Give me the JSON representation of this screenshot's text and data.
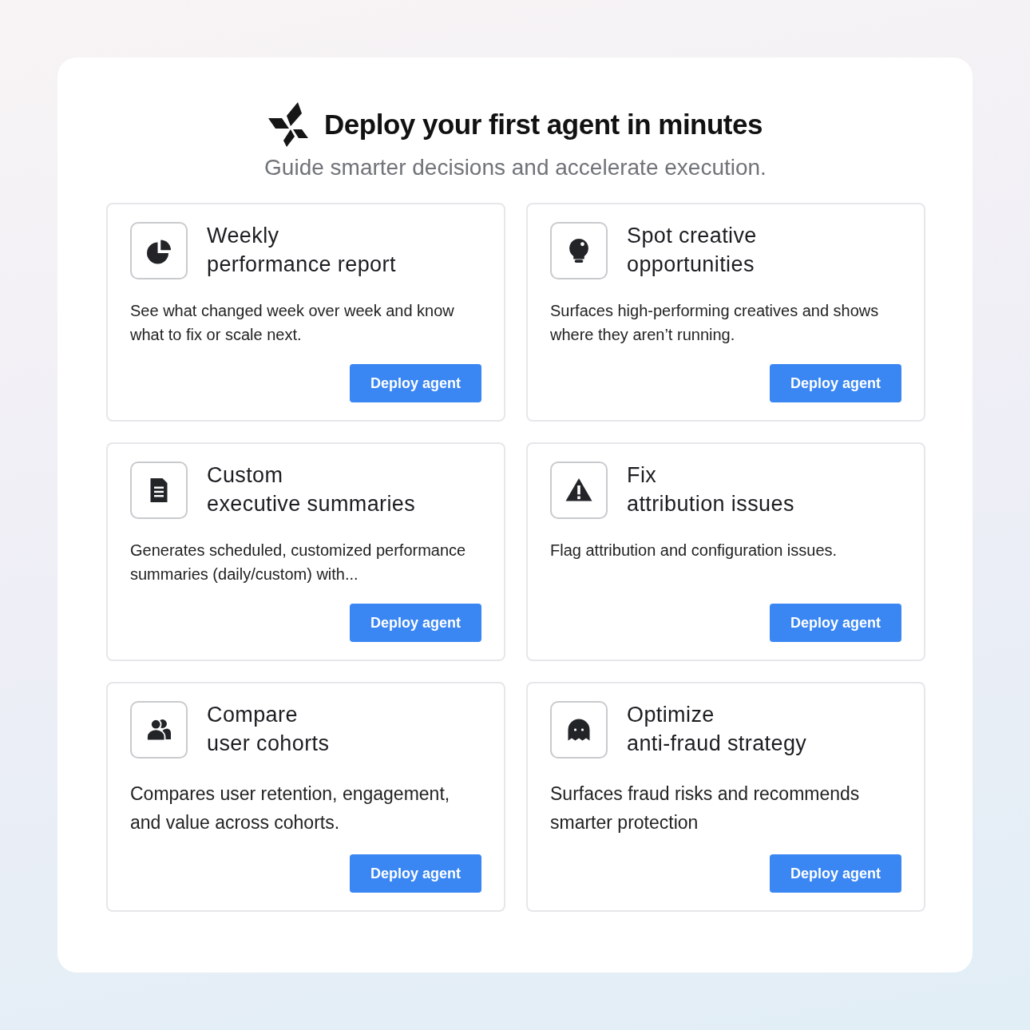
{
  "header": {
    "title": "Deploy your first agent in minutes",
    "subtitle": "Guide smarter decisions and accelerate execution."
  },
  "cards": [
    {
      "title_lines": [
        "Weekly",
        "performance report"
      ],
      "description": "See what changed week over week and know what to fix or scale next.",
      "kind": "regular",
      "button": "Deploy agent"
    },
    {
      "title_lines": [
        "Spot creative",
        "opportunities"
      ],
      "description": "Surfaces high-performing creatives and shows where they aren’t running.",
      "kind": "regular",
      "button": "Deploy agent"
    },
    {
      "title_lines": [
        "Custom",
        "executive summaries"
      ],
      "description": "Generates scheduled, customized performance summaries (daily/custom) with...",
      "kind": "regular",
      "button": "Deploy agent"
    },
    {
      "title_lines": [
        "Fix",
        "attribution issues"
      ],
      "description": "Flag attribution and configuration issues.",
      "kind": "regular",
      "button": "Deploy agent"
    },
    {
      "title_lines": [
        "Compare",
        "user cohorts"
      ],
      "description": "Compares user retention, engagement, and value across cohorts.",
      "kind": "large",
      "button": "Deploy agent"
    },
    {
      "title_lines": [
        "Optimize",
        "anti-fraud strategy"
      ],
      "description": "Surfaces fraud risks and recommends smarter protection",
      "kind": "large",
      "button": "Deploy agent"
    }
  ]
}
